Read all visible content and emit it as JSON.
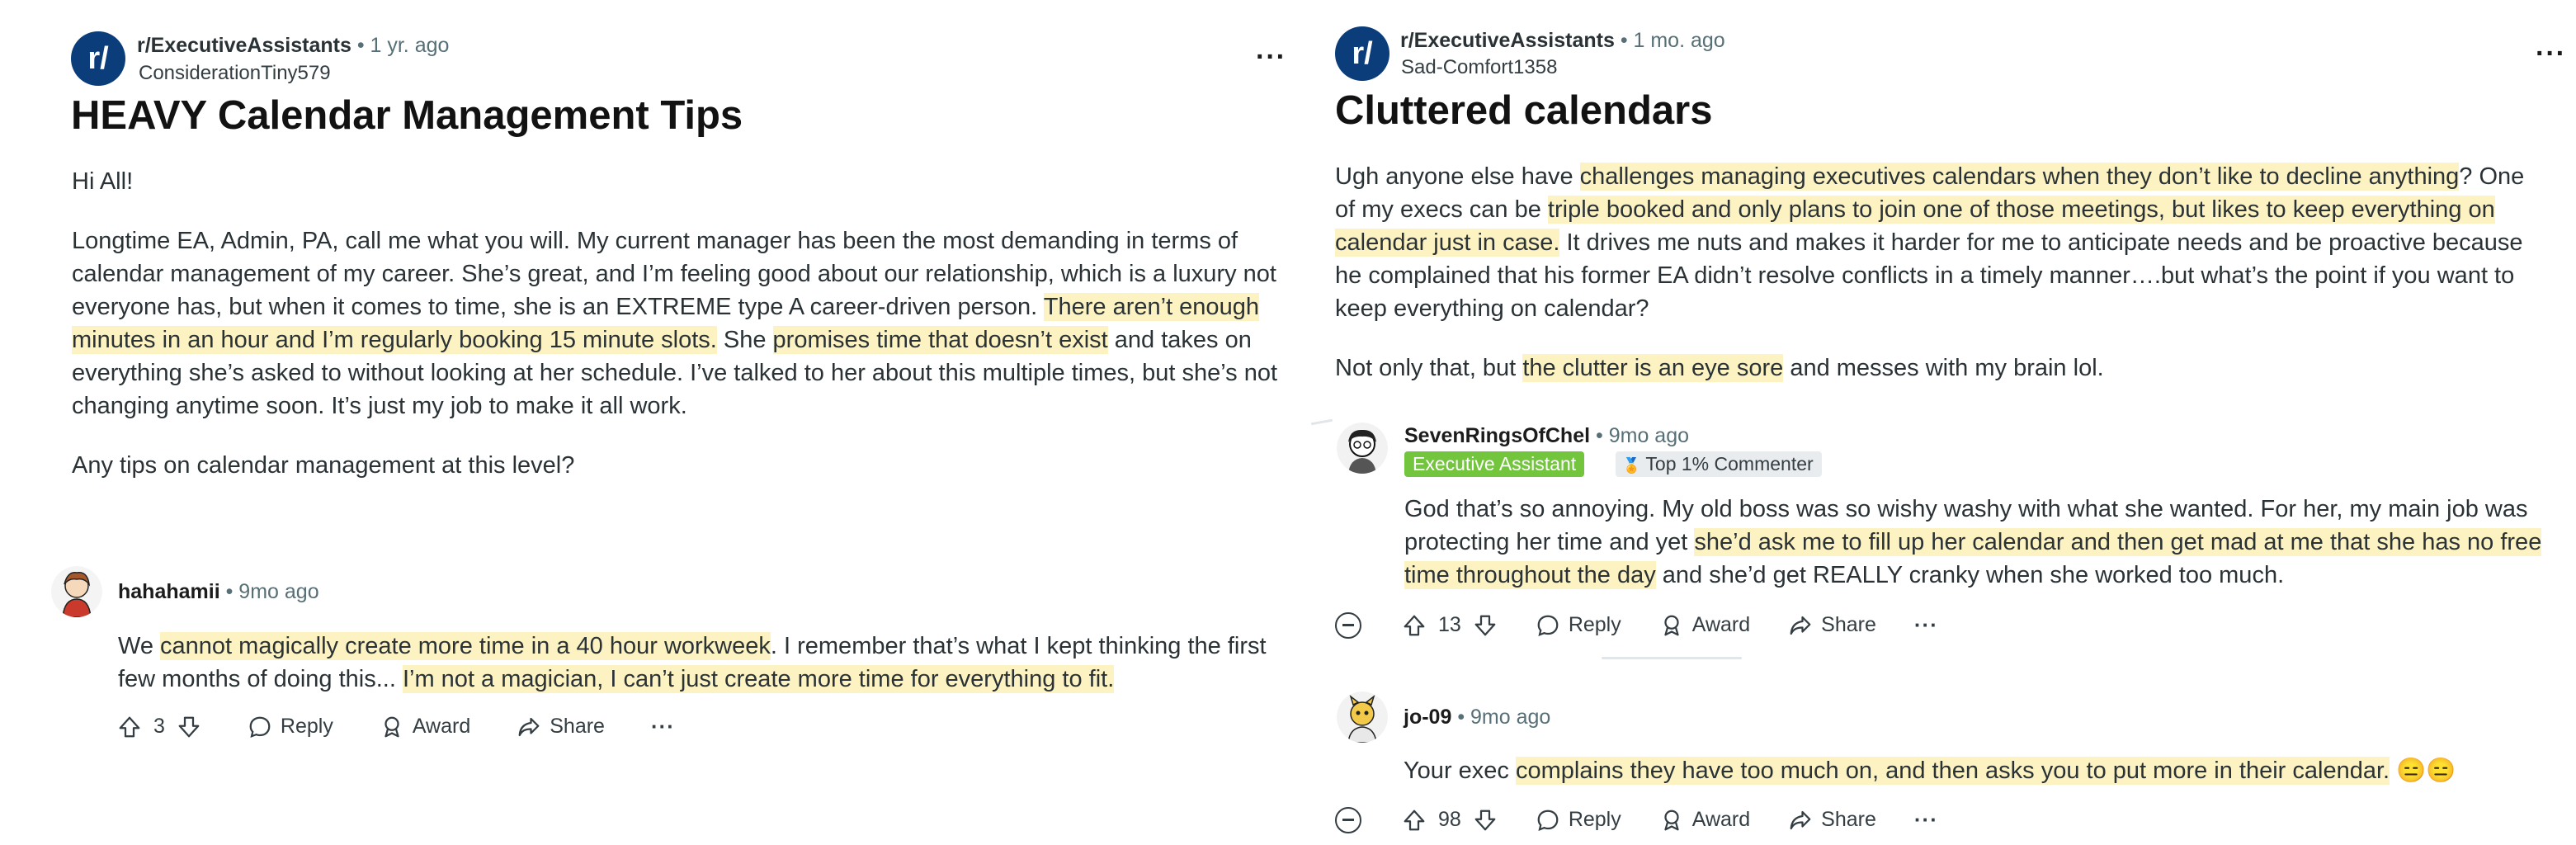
{
  "left": {
    "post": {
      "subreddit": "r/ExecutiveAssistants",
      "time": "• 1 yr. ago",
      "author": "ConsiderationTiny579",
      "title": "HEAVY Calendar Management Tips",
      "p1": "Hi All!",
      "p2_a": "Longtime EA, Admin, PA, call me what you will. My current manager has been the most demanding in terms of calendar management of my career. She’s great, and I’m feeling good about our relationship, which is a luxury not everyone has, but when it comes to time, she is an EXTREME type A career-driven person. ",
      "p2_h1": "There aren’t enough minutes in an hour and I’m regularly booking 15 minute slots.",
      "p2_b": " She ",
      "p2_h2": "promises time that doesn’t exist",
      "p2_c": " and takes on everything she’s asked to without looking at her schedule. I’ve talked to her about this multiple times, but she’s not changing anytime soon. It’s just my job to make it all work.",
      "p3": "Any tips on calendar management at this level?"
    },
    "comment": {
      "user": "hahahamii",
      "time": "• 9mo ago",
      "t_a": "We ",
      "t_h1": "cannot magically create more time in a 40 hour workweek",
      "t_b": ". I remember that’s what I kept thinking the first few months of doing this... ",
      "t_h2": "I’m not a magician, I can’t just create more time for everything to fit.",
      "votes": "3",
      "reply": "Reply",
      "award": "Award",
      "share": "Share",
      "more": "···"
    }
  },
  "right": {
    "post": {
      "subreddit": "r/ExecutiveAssistants",
      "time": "• 1 mo. ago",
      "author": "Sad-Comfort1358",
      "title": "Cluttered calendars",
      "p1_a": "Ugh anyone else have ",
      "p1_h1": "challenges managing executives calendars when they don’t like to decline anything",
      "p1_b": "? One of my execs can be ",
      "p1_h2": "triple booked and only plans to join one of those meetings, but likes to keep everything on calendar just in case.",
      "p1_c": " It drives me nuts and makes it harder for me to anticipate needs and be proactive because he complained that his former EA didn’t resolve conflicts in a timely manner….but what’s the point if you want to keep everything on calendar?",
      "p2_a": "Not only that, but ",
      "p2_h": "the clutter is an eye sore",
      "p2_b": " and messes with my brain lol."
    },
    "comment1": {
      "user": "SevenRingsOfChel",
      "time": "• 9mo ago",
      "flair1": "Executive Assistant",
      "flair2": "Top 1% Commenter",
      "t_a": "God that’s so annoying. My old boss was so wishy washy with what she wanted. For her, my main job was protecting her time and yet ",
      "t_h": "she’d ask me to fill up her calendar and then get mad at me that she has no free time throughout the day",
      "t_b": " and she’d get REALLY cranky when she worked too much.",
      "votes": "13",
      "reply": "Reply",
      "award": "Award",
      "share": "Share",
      "more": "···"
    },
    "comment2": {
      "user": "jo-09",
      "time": "• 9mo ago",
      "t_a": "Your exec ",
      "t_h": "complains they have too much on, and then asks you to put more in their calendar.",
      "t_emoji": " 😑😑",
      "votes": "98",
      "reply": "Reply",
      "award": "Award",
      "share": "Share",
      "more": "···"
    }
  },
  "colors": {
    "highlight": "#fdf3c2",
    "subreddit_icon": "#0a3d7a",
    "flair_ea": "#74c53e",
    "flair_top": "#e9ecee"
  },
  "icons": [
    "upvote-icon",
    "downvote-icon",
    "reply-bubble-icon",
    "award-icon",
    "share-icon",
    "collapse-icon"
  ]
}
